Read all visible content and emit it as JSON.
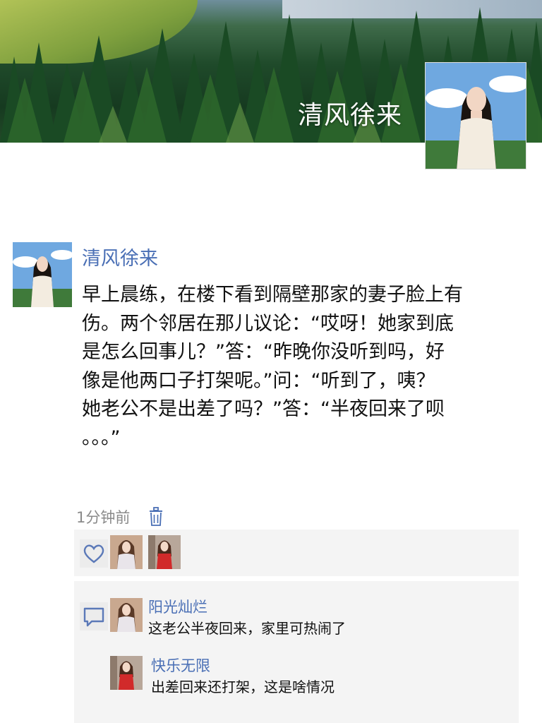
{
  "header": {
    "title": "清风徐来",
    "profile_avatar": "profile-photo-woman"
  },
  "post": {
    "author": "清风徐来",
    "avatar": "profile-photo-woman",
    "lines": [
      "早上晨练，在楼下看到隔壁那家的妻子脸上有",
      "伤。两个邻居在那儿议论：“哎呀！她家到底",
      "是怎么回事儿？”答：“昨晚你没听到吗，好",
      "像是他两口子打架呢。”问：“听到了，咦？",
      "她老公不是出差了吗？”答：“半夜回来了呗",
      "。。。”"
    ],
    "timestamp": "1分钟前",
    "delete_icon": "trash-icon"
  },
  "likes": {
    "icon": "heart-icon",
    "avatars": [
      "liker-avatar-1",
      "liker-avatar-2"
    ]
  },
  "comments": {
    "icon": "comment-icon",
    "items": [
      {
        "name": "阳光灿烂",
        "text": "这老公半夜回来，家里可热闹了"
      },
      {
        "name": "快乐无限",
        "text": "出差回来还打架，这是啥情况"
      }
    ]
  },
  "colors": {
    "link": "#4a6fb5",
    "timestamp": "#8a8a8a",
    "panel_bg": "#f4f4f4"
  }
}
